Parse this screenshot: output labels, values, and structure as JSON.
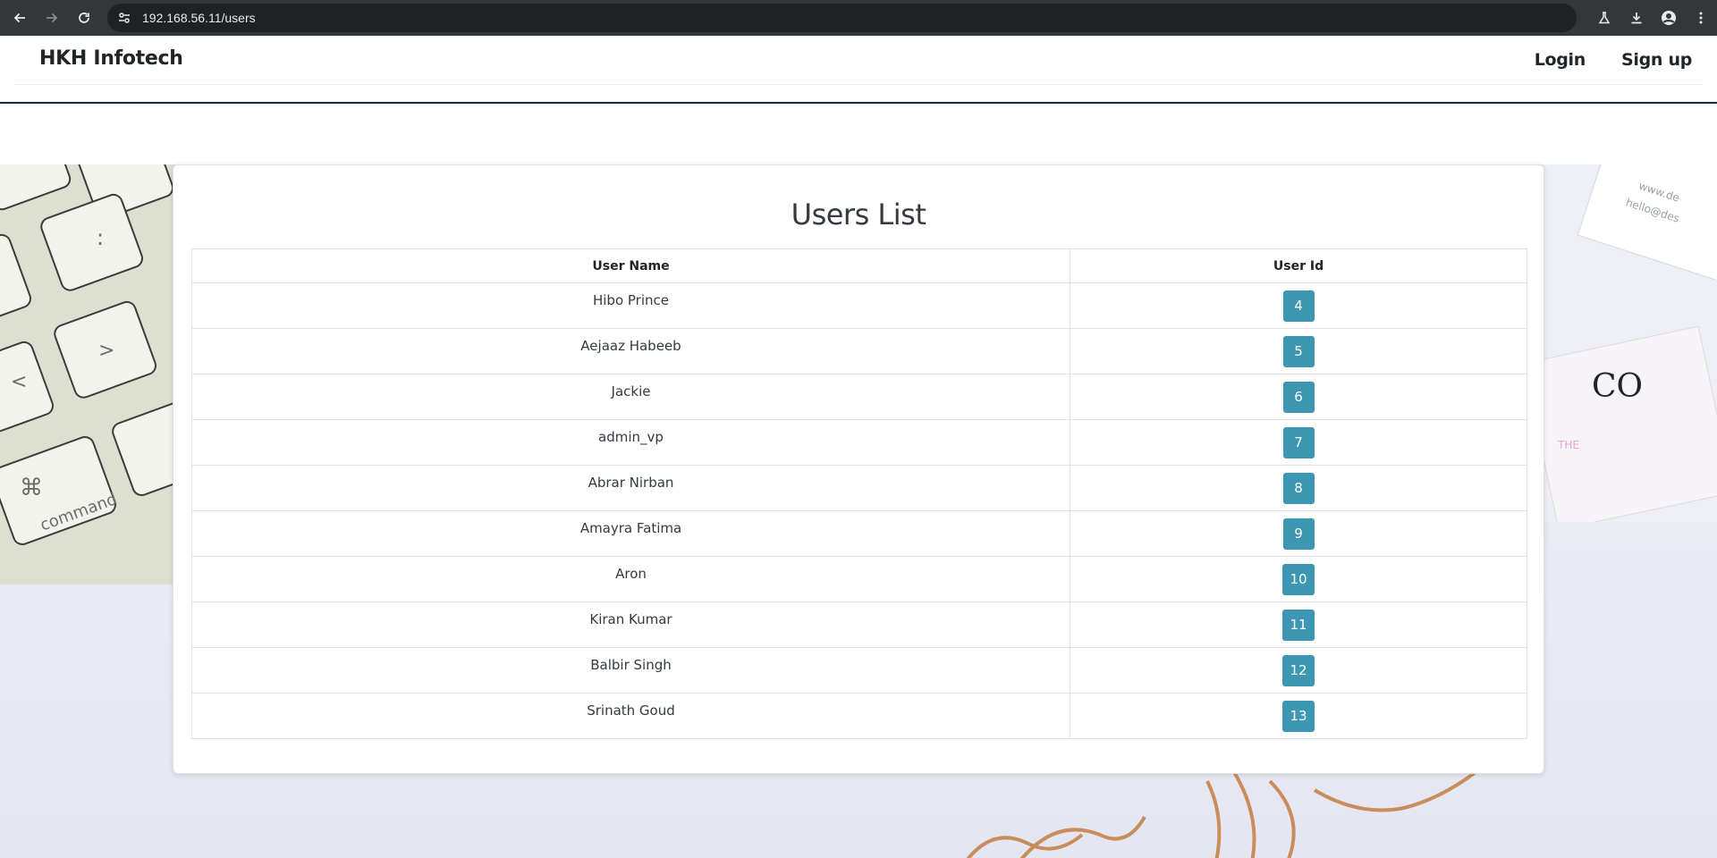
{
  "browser": {
    "url": "192.168.56.11/users",
    "back_icon": "arrow-left",
    "forward_icon": "arrow-right",
    "reload_icon": "reload",
    "site_info_icon": "tune",
    "tools": [
      "labs-icon",
      "download-icon",
      "profile-icon",
      "menu-icon"
    ]
  },
  "navbar": {
    "brand": "HKH Infotech",
    "login": "Login",
    "signup": "Sign up"
  },
  "main": {
    "title": "Users List",
    "table": {
      "headers": [
        "User Name",
        "User Id"
      ],
      "rows": [
        {
          "name": "Hibo Prince",
          "id": "4"
        },
        {
          "name": "Aejaaz Habeeb",
          "id": "5"
        },
        {
          "name": "Jackie",
          "id": "6"
        },
        {
          "name": "admin_vp",
          "id": "7"
        },
        {
          "name": "Abrar Nirban",
          "id": "8"
        },
        {
          "name": "Amayra Fatima",
          "id": "9"
        },
        {
          "name": "Aron",
          "id": "10"
        },
        {
          "name": "Kiran Kumar",
          "id": "11"
        },
        {
          "name": "Balbir Singh",
          "id": "12"
        },
        {
          "name": "Srinath Goud",
          "id": "13"
        }
      ]
    }
  },
  "colors": {
    "badge": "#3d97b2",
    "navbar_border": "#1d2b45",
    "chrome": "#35363a"
  }
}
